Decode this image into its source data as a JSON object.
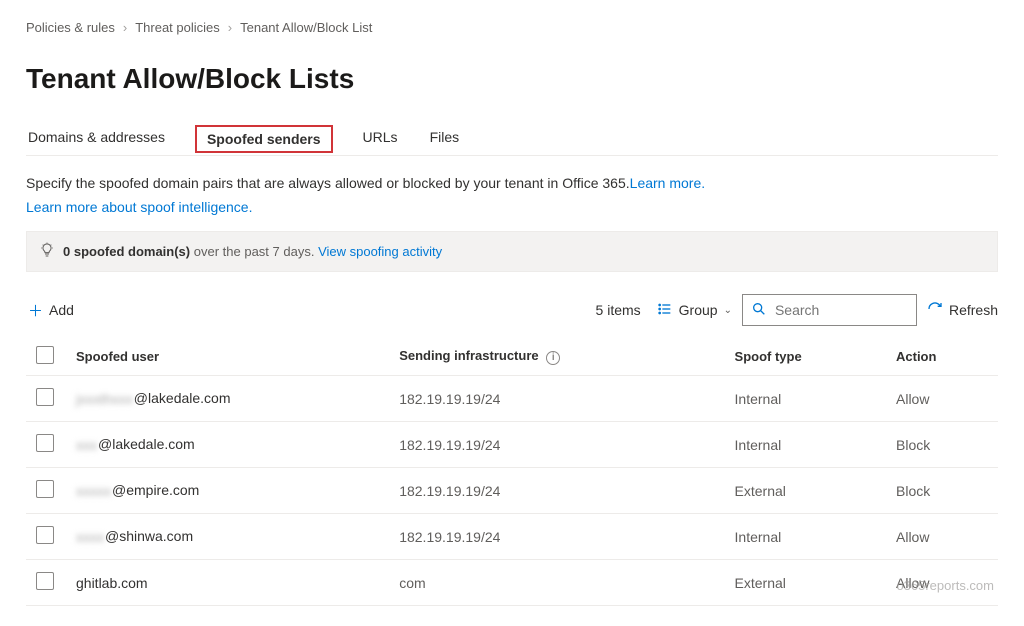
{
  "breadcrumb": {
    "items": [
      "Policies & rules",
      "Threat policies",
      "Tenant Allow/Block List"
    ]
  },
  "page_title": "Tenant Allow/Block Lists",
  "tabs": {
    "items": [
      {
        "label": "Domains & addresses",
        "active": false
      },
      {
        "label": "Spoofed senders",
        "active": true
      },
      {
        "label": "URLs",
        "active": false
      },
      {
        "label": "Files",
        "active": false
      }
    ]
  },
  "description": {
    "text": "Specify the spoofed domain pairs that are always allowed or blocked by your tenant in Office 365.",
    "learn_more": "Learn more.",
    "spoof_intel_link": "Learn more about spoof intelligence."
  },
  "banner": {
    "count_text": "0 spoofed domain(s)",
    "rest": "over the past 7 days.",
    "link": "View spoofing activity"
  },
  "toolbar": {
    "add_label": "Add",
    "items_count": "5 items",
    "group_label": "Group",
    "search_placeholder": "Search",
    "refresh_label": "Refresh"
  },
  "table": {
    "columns": {
      "spoofed_user": "Spoofed user",
      "sending_infra": "Sending infrastructure",
      "spoof_type": "Spoof type",
      "action": "Action"
    },
    "rows": [
      {
        "prefix": "jxxxthxxx",
        "domain": "@lakedale.com",
        "infra": "182.19.19.19/24",
        "spoof_type": "Internal",
        "action": "Allow"
      },
      {
        "prefix": "xxx",
        "domain": "@lakedale.com",
        "infra": "182.19.19.19/24",
        "spoof_type": "Internal",
        "action": "Block"
      },
      {
        "prefix": "xxxxx",
        "domain": "@empire.com",
        "infra": "182.19.19.19/24",
        "spoof_type": "External",
        "action": "Block"
      },
      {
        "prefix": "xxxx",
        "domain": "@shinwa.com",
        "infra": "182.19.19.19/24",
        "spoof_type": "Internal",
        "action": "Allow"
      },
      {
        "prefix": "",
        "domain": "ghitlab.com",
        "infra": "com",
        "spoof_type": "External",
        "action": "Allow"
      }
    ]
  },
  "watermark": "o365reports.com"
}
